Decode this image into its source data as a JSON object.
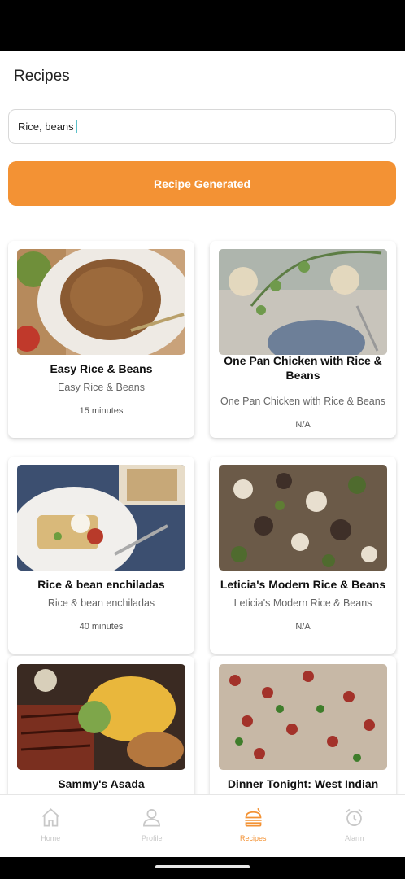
{
  "header": {
    "title": "Recipes"
  },
  "search": {
    "value": "Rice, beans",
    "placeholder": ""
  },
  "generate_button": {
    "label": "Recipe Generated"
  },
  "recipes": [
    {
      "title": "Easy Rice & Beans",
      "subtitle": "Easy Rice & Beans",
      "time": "15 minutes"
    },
    {
      "title": "One Pan Chicken with Rice & Beans",
      "subtitle": "One Pan Chicken with Rice & Beans",
      "time": "N/A"
    },
    {
      "title": "Rice & bean enchiladas",
      "subtitle": "Rice & bean enchiladas",
      "time": "40 minutes"
    },
    {
      "title": "Leticia's Modern Rice & Beans",
      "subtitle": "Leticia's Modern Rice & Beans",
      "time": "N/A"
    },
    {
      "title": "Sammy's Asada",
      "subtitle": "",
      "time": ""
    },
    {
      "title": "Dinner Tonight: West Indian",
      "subtitle": "",
      "time": ""
    }
  ],
  "nav": {
    "items": [
      {
        "label": "Home",
        "icon": "home-icon",
        "active": false
      },
      {
        "label": "Profile",
        "icon": "profile-icon",
        "active": false
      },
      {
        "label": "Recipes",
        "icon": "burger-icon",
        "active": true
      },
      {
        "label": "Alarm",
        "icon": "alarm-icon",
        "active": false
      }
    ]
  },
  "colors": {
    "accent": "#f39234",
    "inactive": "#c8c8c8",
    "caret": "#5cc0c9"
  }
}
